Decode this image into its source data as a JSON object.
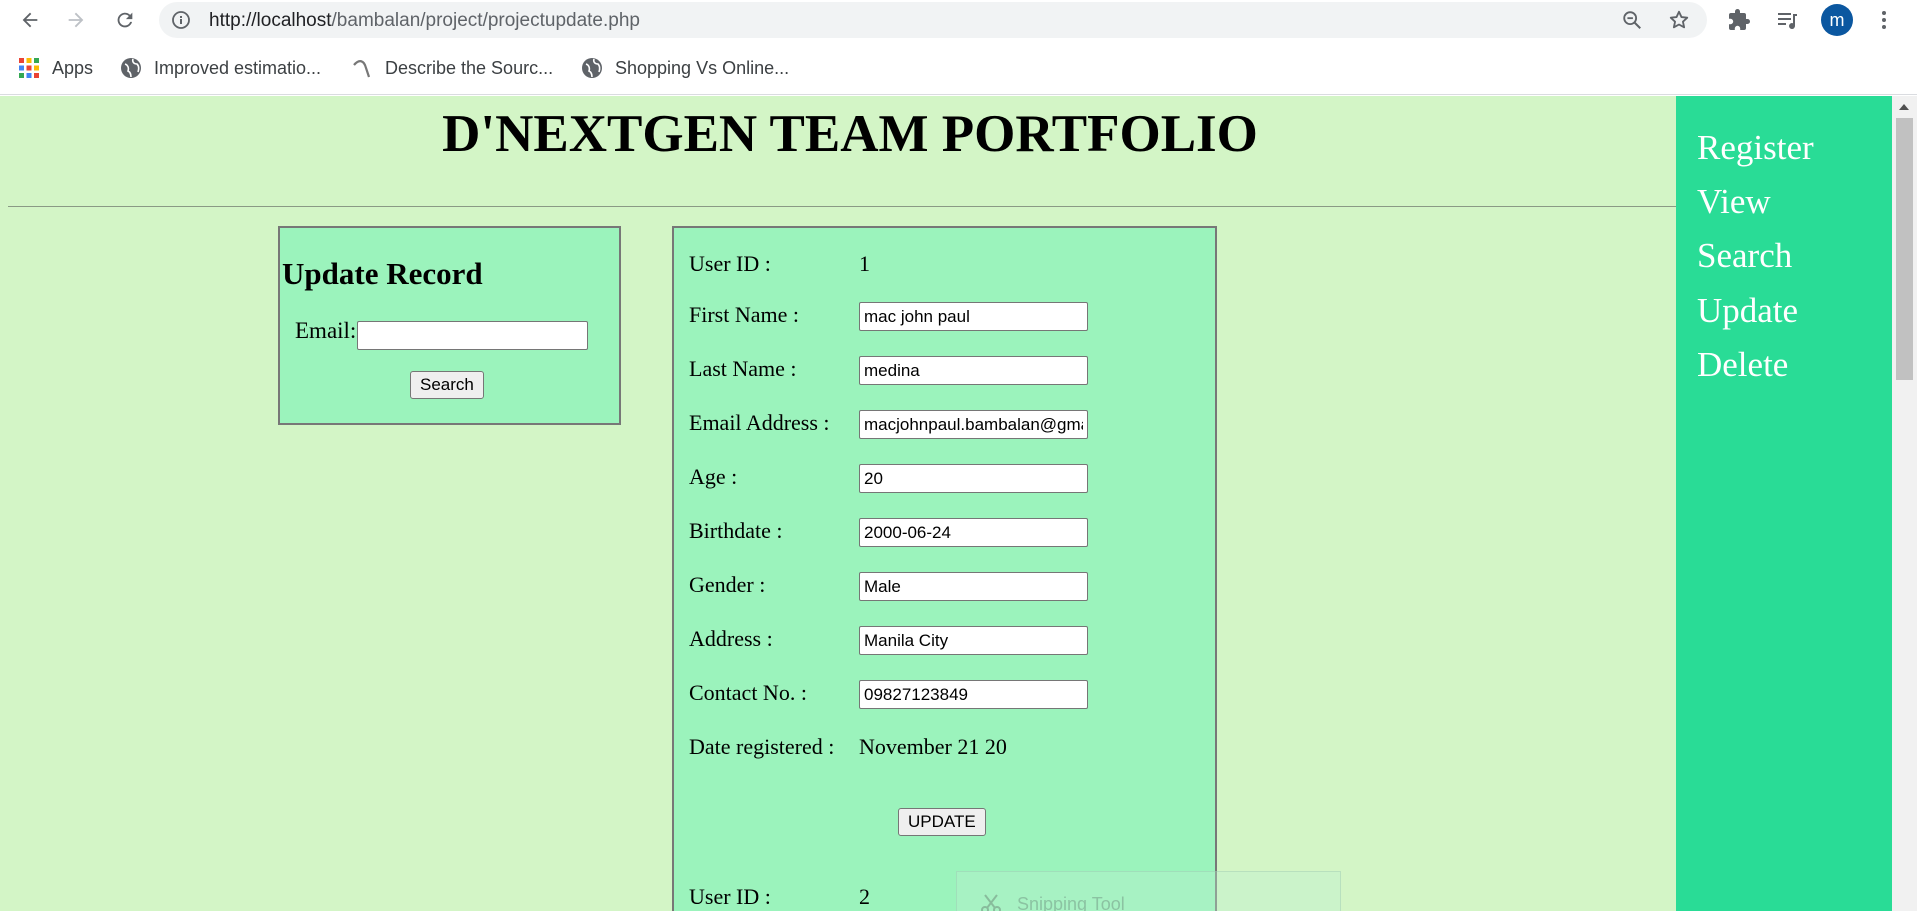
{
  "browser": {
    "url_host": "http://localhost",
    "url_path": "/bambalan/project/projectupdate.php",
    "profile_initial": "m",
    "bookmarks": [
      {
        "label": "Apps",
        "icon": "apps-grid-icon"
      },
      {
        "label": "Improved estimatio...",
        "icon": "globe-icon"
      },
      {
        "label": "Describe the Sourc...",
        "icon": "arc-icon"
      },
      {
        "label": "Shopping Vs Online...",
        "icon": "globe-icon"
      }
    ]
  },
  "page": {
    "title": "D'NEXTGEN TEAM PORTFOLIO",
    "background_color": "#d3f5c6",
    "panel_color": "#9bf3bc",
    "nav_color": "#29dc96"
  },
  "search_panel": {
    "heading": "Update Record",
    "email_label": "Email:",
    "email_value": "",
    "search_button": "Search"
  },
  "record": {
    "user_id_label": "User ID :",
    "user_id": "1",
    "fields": [
      {
        "label": "First Name :",
        "value": "mac john paul"
      },
      {
        "label": "Last Name :",
        "value": "medina"
      },
      {
        "label": "Email Address :",
        "value": "macjohnpaul.bambalan@gmail.com"
      },
      {
        "label": "Age :",
        "value": "20"
      },
      {
        "label": "Birthdate :",
        "value": "2000-06-24"
      },
      {
        "label": "Gender :",
        "value": "Male"
      },
      {
        "label": "Address :",
        "value": "Manila City"
      },
      {
        "label": "Contact No. :",
        "value": "09827123849"
      }
    ],
    "date_registered_label": "Date registered :",
    "date_registered": "November 21 20",
    "update_button": "UPDATE",
    "next_user_id_label": "User ID :",
    "next_user_id": "2"
  },
  "sidenav": {
    "items": [
      "Register",
      "View",
      "Search",
      "Update",
      "Delete"
    ]
  },
  "overlay": {
    "snipping_tool": "Snipping Tool"
  }
}
